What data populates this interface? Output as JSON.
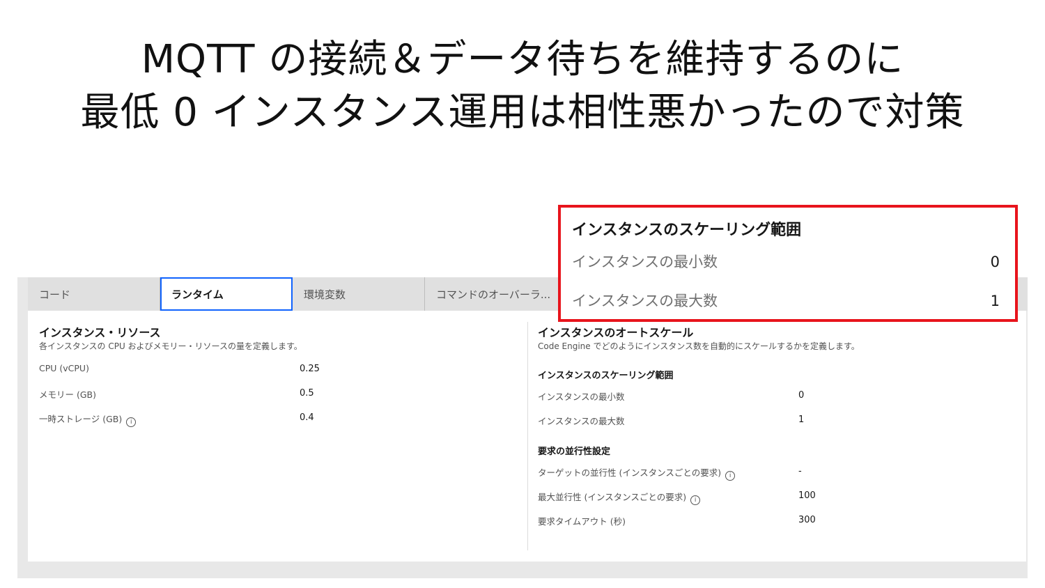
{
  "slide": {
    "title_line1": "MQTT の接続＆データ待ちを維持するのに",
    "title_line2": "最低 0 インスタンス運用は相性悪かったので対策"
  },
  "tabs": [
    {
      "label": "コード",
      "active": false
    },
    {
      "label": "ランタイム",
      "active": true
    },
    {
      "label": "環境変数",
      "active": false
    },
    {
      "label": "コマンドのオーバーラ...",
      "active": false
    }
  ],
  "resources": {
    "title": "インスタンス・リソース",
    "description": "各インスタンスの CPU およびメモリー・リソースの量を定義します。",
    "rows": [
      {
        "label": "CPU (vCPU)",
        "value": "0.25",
        "info": false
      },
      {
        "label": "メモリー (GB)",
        "value": "0.5",
        "info": false
      },
      {
        "label": "一時ストレージ (GB)",
        "value": "0.4",
        "info": true
      }
    ]
  },
  "autoscale": {
    "title": "インスタンスのオートスケール",
    "description": "Code Engine でどのようにインスタンス数を自動的にスケールするかを定義します。",
    "scaling_title": "インスタンスのスケーリング範囲",
    "scaling_rows": [
      {
        "label": "インスタンスの最小数",
        "value": "0"
      },
      {
        "label": "インスタンスの最大数",
        "value": "1"
      }
    ],
    "concurrency_title": "要求の並行性設定",
    "concurrency_rows": [
      {
        "label": "ターゲットの並行性 (インスタンスごとの要求)",
        "value": "-",
        "info": true
      },
      {
        "label": "最大並行性 (インスタンスごとの要求)",
        "value": "100",
        "info": true
      },
      {
        "label": "要求タイムアウト (秒)",
        "value": "300",
        "info": false
      }
    ]
  },
  "callout": {
    "title": "インスタンスのスケーリング範囲",
    "rows": [
      {
        "label": "インスタンスの最小数",
        "value": "0"
      },
      {
        "label": "インスタンスの最大数",
        "value": "1"
      }
    ],
    "border_color": "#e8141c"
  },
  "icons": {
    "info": "info-icon"
  },
  "colors": {
    "accent": "#0f62fe",
    "highlight": "#e8141c"
  }
}
